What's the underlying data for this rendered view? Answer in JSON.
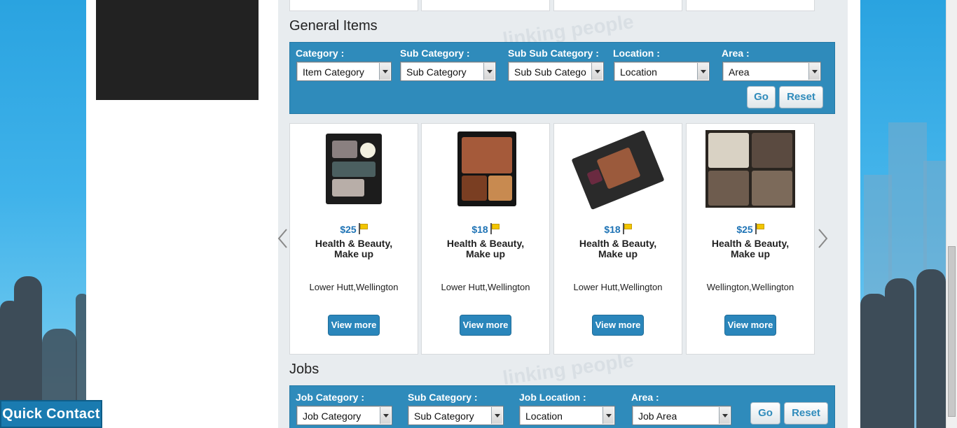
{
  "sections": {
    "general": {
      "title": "General Items",
      "filters": [
        {
          "label": "Category :",
          "value": "Item Category"
        },
        {
          "label": "Sub Category :",
          "value": "Sub Category"
        },
        {
          "label": "Sub Sub Category :",
          "value": "Sub Sub Catego"
        },
        {
          "label": "Location :",
          "value": "Location"
        },
        {
          "label": "Area :",
          "value": "Area"
        }
      ],
      "go_label": "Go",
      "reset_label": "Reset"
    },
    "jobs": {
      "title": "Jobs",
      "filters": [
        {
          "label": "Job Category :",
          "value": "Job Category"
        },
        {
          "label": "Sub Category :",
          "value": "Sub Category"
        },
        {
          "label": "Job Location :",
          "value": "Location"
        },
        {
          "label": "Area :",
          "value": "Area"
        }
      ],
      "area_value": "Job Area",
      "go_label": "Go",
      "reset_label": "Reset"
    }
  },
  "products": [
    {
      "price": "$25",
      "name_line1": "Health & Beauty,",
      "name_line2": "Make up",
      "location": "Lower Hutt,Wellington",
      "button": "View more"
    },
    {
      "price": "$18",
      "name_line1": "Health & Beauty,",
      "name_line2": "Make up",
      "location": "Lower Hutt,Wellington",
      "button": "View more"
    },
    {
      "price": "$18",
      "name_line1": "Health & Beauty,",
      "name_line2": "Make up",
      "location": "Lower Hutt,Wellington",
      "button": "View more"
    },
    {
      "price": "$25",
      "name_line1": "Health & Beauty,",
      "name_line2": "Make up",
      "location": "Wellington,Wellington",
      "button": "View more"
    }
  ],
  "watermark": "linking people",
  "quick_contact": "Quick Contact",
  "colors": {
    "accent": "#2f8bbb",
    "price": "#1e73b5",
    "background": "#2ea0dc"
  }
}
